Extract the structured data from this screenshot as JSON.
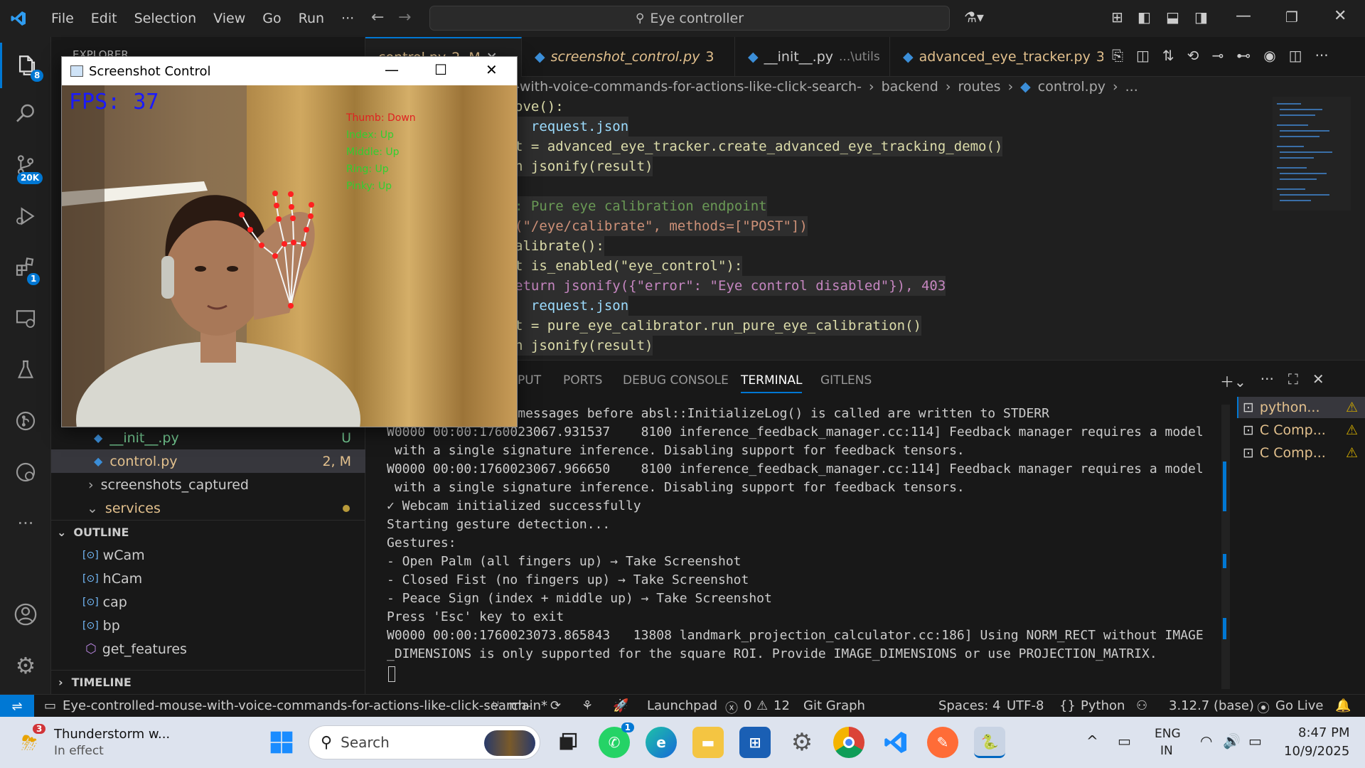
{
  "titlebar": {
    "menus": [
      "File",
      "Edit",
      "Selection",
      "View",
      "Go",
      "Run",
      "···"
    ],
    "search": "Eye controller"
  },
  "activity": {
    "explorer_badge": "8",
    "scm_badge": "20K",
    "extensions_badge": "1"
  },
  "sidebar": {
    "explorer_header": "EXPLORER",
    "files": [
      {
        "name": "__init__.py",
        "status": "U"
      },
      {
        "name": "control.py",
        "status": "2, M"
      }
    ],
    "folders": [
      {
        "name": "screenshots_captured"
      },
      {
        "name": "services"
      }
    ],
    "outline_header": "OUTLINE",
    "outline_items": [
      "wCam",
      "hCam",
      "cap",
      "bp",
      "get_features"
    ],
    "timeline_header": "TIMELINE"
  },
  "tabs": [
    {
      "label": "control.py",
      "meta": "2, M"
    },
    {
      "label": "screenshot_control.py",
      "meta": "3"
    },
    {
      "label": "__init__.py",
      "meta": "...\\utils"
    },
    {
      "label": "advanced_eye_tracker.py",
      "meta": "3, M"
    }
  ],
  "breadcrumb": [
    "-with-voice-commands-for-actions-like-click-search-",
    "backend",
    "routes",
    "control.py",
    "..."
  ],
  "code_lines": [
    "ove():",
    "  request.json",
    "t = advanced_eye_tracker.create_advanced_eye_tracking_demo()",
    "n jsonify(result)",
    "",
    ": Pure eye calibration endpoint",
    "(\"/eye/calibrate\", methods=[\"POST\"])",
    "alibrate():",
    "t is_enabled(\"eye_control\"):",
    "eturn jsonify({\"error\": \"Eye control disabled\"}), 403",
    "  request.json",
    "t = pure_eye_calibrator.run_pure_eye_calibration()",
    "n jsonify(result)"
  ],
  "panel": {
    "tabs": [
      "PUT",
      "PORTS",
      "DEBUG CONSOLE",
      "TERMINAL",
      "GITLENS"
    ],
    "active_tab": "TERMINAL",
    "terminal_lines": [
      "WARNING: All log messages before absl::InitializeLog() is called are written to STDERR",
      "W0000 00:00:1760023067.931537    8100 inference_feedback_manager.cc:114] Feedback manager requires a model",
      " with a single signature inference. Disabling support for feedback tensors.",
      "W0000 00:00:1760023067.966650    8100 inference_feedback_manager.cc:114] Feedback manager requires a model",
      " with a single signature inference. Disabling support for feedback tensors.",
      "✓ Webcam initialized successfully",
      "Starting gesture detection...",
      "Gestures:",
      "- Open Palm (all fingers up) → Take Screenshot",
      "- Closed Fist (no fingers up) → Take Screenshot",
      "- Peace Sign (index + middle up) → Take Screenshot",
      "Press 'Esc' key to exit",
      "W0000 00:00:1760023073.865843   13808 landmark_projection_calculator.cc:186] Using NORM_RECT without IMAGE",
      "_DIMENSIONS is only supported for the square ROI. Provide IMAGE_DIMENSIONS or use PROJECTION_MATRIX."
    ],
    "terminals": [
      "python...",
      "C Comp...",
      "C Comp..."
    ]
  },
  "statusbar": {
    "folder": "Eye-controlled-mouse-with-voice-commands-for-actions-like-click-search-",
    "branch": "main*",
    "launchpad": "Launchpad",
    "problems": "0",
    "warnings": "12",
    "gitgraph": "Git Graph",
    "spaces": "Spaces: 4",
    "encoding": "UTF-8",
    "language": "Python",
    "interpreter": "3.12.7 (base)",
    "golive": "Go Live"
  },
  "window": {
    "title": "Screenshot Control",
    "fps": "FPS: 37",
    "gesture_labels": [
      "Thumb: Down",
      "Index: Up",
      "Middle: Up",
      "Ring: Up",
      "Pinky: Up"
    ]
  },
  "taskbar": {
    "weather_title": "Thunderstorm w...",
    "weather_sub": "In effect",
    "weather_badge": "3",
    "search": "Search",
    "whatsapp_badge": "1",
    "lang1": "ENG",
    "lang2": "IN",
    "time": "8:47 PM",
    "date": "10/9/2025"
  },
  "colors": {
    "accent": "#0078d4",
    "warning_tab": "#e2c08d",
    "fps_text": "#1a1aff",
    "landmark": "#ff2020"
  }
}
